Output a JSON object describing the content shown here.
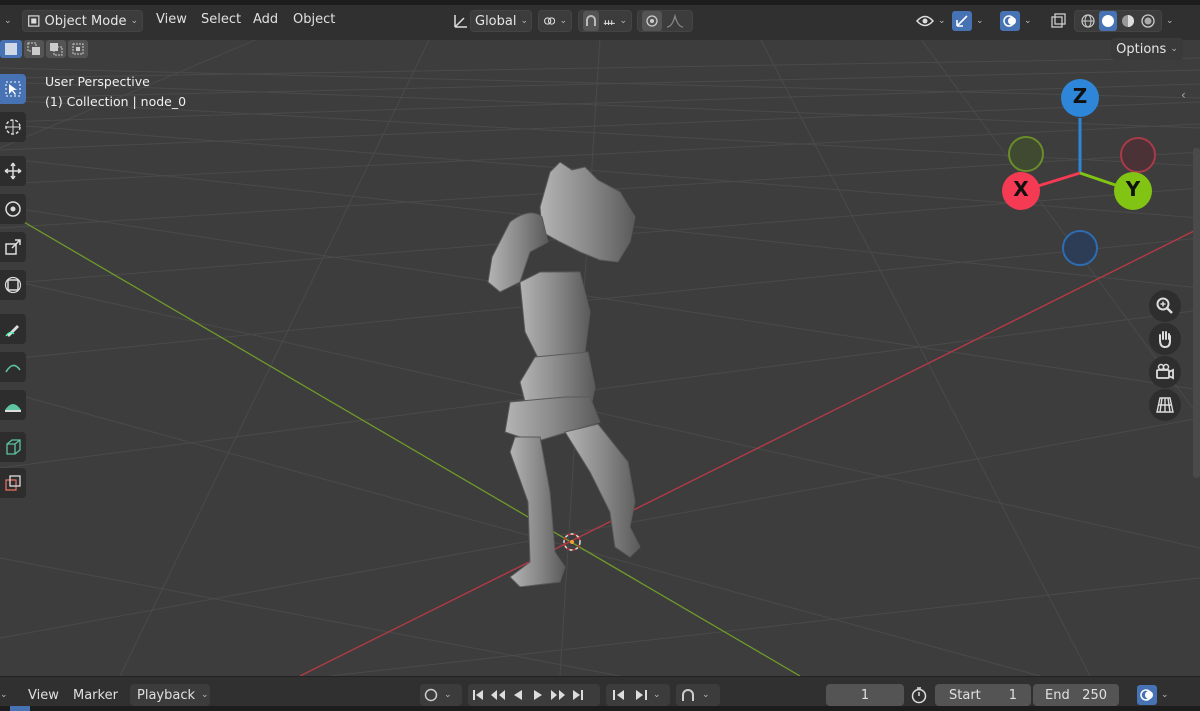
{
  "header": {
    "mode_label": "Object Mode",
    "menus": [
      "View",
      "Select",
      "Add",
      "Object"
    ],
    "transform_orientation": "Global",
    "options_label": "Options"
  },
  "viewport": {
    "view_name": "User Perspective",
    "collection_info": "(1) Collection | node_0",
    "gizmo": {
      "z": "Z",
      "x": "X",
      "y": "Y"
    },
    "colors": {
      "x_axis": "#f53a53",
      "y_axis": "#82c414",
      "z_axis": "#2e86d9",
      "background": "#3d3d3d"
    }
  },
  "toolbar": {
    "tools": [
      "select-box-icon",
      "cursor-icon",
      "move-icon",
      "rotate-icon",
      "scale-icon",
      "transform-icon",
      "annotate-icon",
      "measure-icon",
      "add-cube-icon",
      "add-object-icon"
    ]
  },
  "navigation": [
    "zoom-icon",
    "pan-hand-icon",
    "camera-view-icon",
    "ortho-grid-icon"
  ],
  "timeline": {
    "menus": [
      "View",
      "Marker",
      "Playback"
    ],
    "current_frame": "1",
    "start_label": "Start",
    "start_value": "1",
    "end_label": "End",
    "end_value": "250"
  }
}
